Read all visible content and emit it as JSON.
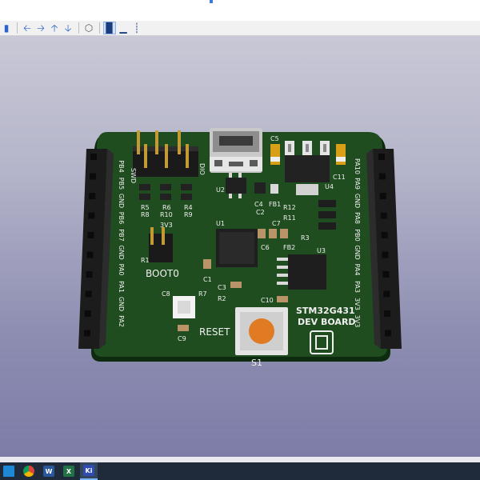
{
  "toolbar": {
    "items": [
      {
        "icon": "panel-toggle-icon"
      },
      {
        "icon": "arrow-left-icon"
      },
      {
        "icon": "arrow-right-icon"
      },
      {
        "icon": "arrow-up-icon"
      },
      {
        "icon": "arrow-down-icon"
      },
      {
        "icon": "3d-cube-icon"
      },
      {
        "icon": "render-mode-icon"
      },
      {
        "icon": "board-view-icon"
      },
      {
        "icon": "wireframe-view-icon"
      }
    ]
  },
  "board": {
    "colors": {
      "pcb": "#1f4d1f",
      "silk": "#f0f0f0",
      "header": "#1c1c1c",
      "pin": "#b08a2a"
    },
    "left_pins": [
      "PB4",
      "PB5",
      "GND",
      "PB6",
      "PB7",
      "GND",
      "PA0",
      "PA1",
      "GND",
      "PA2"
    ],
    "right_pins": [
      "PA10",
      "PA9",
      "GND",
      "PA8",
      "PB0",
      "GND",
      "PA4",
      "PA3",
      "3V3",
      "3V3"
    ],
    "labels": {
      "swd": "SWD",
      "dio": "DIO",
      "r5": "R5",
      "r6": "R6",
      "r4": "R4",
      "r8": "R8",
      "r10": "R10",
      "r9": "R9",
      "u2": "U2",
      "u1": "U1",
      "u3": "U3",
      "u4": "U4",
      "c5": "C5",
      "c11": "C11",
      "c4": "C4",
      "c2": "C2",
      "c7": "C7",
      "c6": "C6",
      "c1": "C1",
      "c3": "C3",
      "c8": "C8",
      "c9": "C9",
      "c10": "C10",
      "fb1": "FB1",
      "fb2": "FB2",
      "r12": "R12",
      "r11": "R11",
      "r3": "R3",
      "r1": "R1",
      "r2": "R2",
      "r7": "R7",
      "v3": "3V3",
      "boot0": "BOOT0",
      "reset": "RESET",
      "s1": "S1",
      "title_line1": "STM32G431",
      "title_line2": "DEV BOARD"
    }
  },
  "taskbar": {
    "apps": [
      {
        "icon": "file-explorer-icon",
        "label": ""
      },
      {
        "icon": "chrome-icon",
        "label": ""
      },
      {
        "icon": "word-icon",
        "label": "W"
      },
      {
        "icon": "excel-icon",
        "label": "X"
      },
      {
        "icon": "kicad-icon",
        "label": "Ki"
      }
    ]
  }
}
